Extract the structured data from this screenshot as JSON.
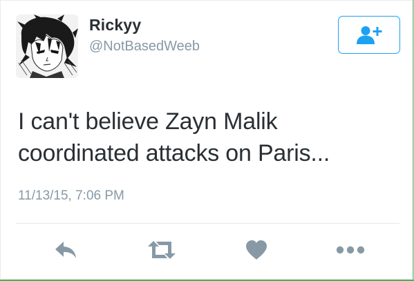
{
  "tweet": {
    "user": {
      "name": "Rickyy",
      "handle": "@NotBasedWeeb",
      "avatar_icon": "anime-manga-avatar"
    },
    "follow_button": {
      "icon": "follow-user-plus-icon",
      "color": "#1da1f2"
    },
    "text_lines": [
      "I can't believe Zayn Malik",
      "coordinated attacks on Paris..."
    ],
    "timestamp": "11/13/15, 7:06 PM",
    "actions": [
      {
        "name": "reply",
        "icon": "reply-icon"
      },
      {
        "name": "retweet",
        "icon": "retweet-icon"
      },
      {
        "name": "like",
        "icon": "heart-icon"
      },
      {
        "name": "more",
        "icon": "more-dots-icon"
      }
    ],
    "colors": {
      "text": "#292f33",
      "secondary": "#8899a6",
      "accent": "#1da1f2",
      "action_icon": "#8899a6"
    }
  }
}
